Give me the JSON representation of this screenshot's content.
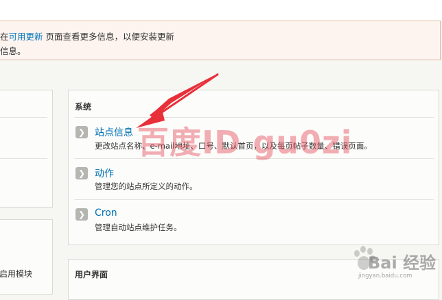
{
  "notice": {
    "line1_prefix": "在",
    "line1_link": "可用更新",
    "line1_suffix": " 页面查看更多信息，以便安装更新",
    "line2": "信息。"
  },
  "left_panel": {
    "partial_text": "启用模块"
  },
  "system_panel": {
    "title": "系统",
    "items": [
      {
        "title": "站点信息",
        "desc": "更改站点名称、e-mail地址、口号、默认首页，以及每页帖子数量、错误页面。"
      },
      {
        "title": "动作",
        "desc": "管理您的站点所定义的动作。"
      },
      {
        "title": "Cron",
        "desc": "管理自动站点维护任务。"
      }
    ]
  },
  "ui_panel": {
    "title": "用户界面"
  },
  "watermark": {
    "text": "百度ID gu0zi"
  },
  "logo": {
    "brand": "Bai 经验",
    "url": "jingyan.baidu.com"
  },
  "icons": {
    "item_chevron": "chevron-right-icon",
    "annotation": "arrow-icon"
  },
  "colors": {
    "link": "#0071b5",
    "notice_bg": "#fdf4ef",
    "notice_border": "#e0b6a3",
    "arrow": "#e8303a"
  }
}
